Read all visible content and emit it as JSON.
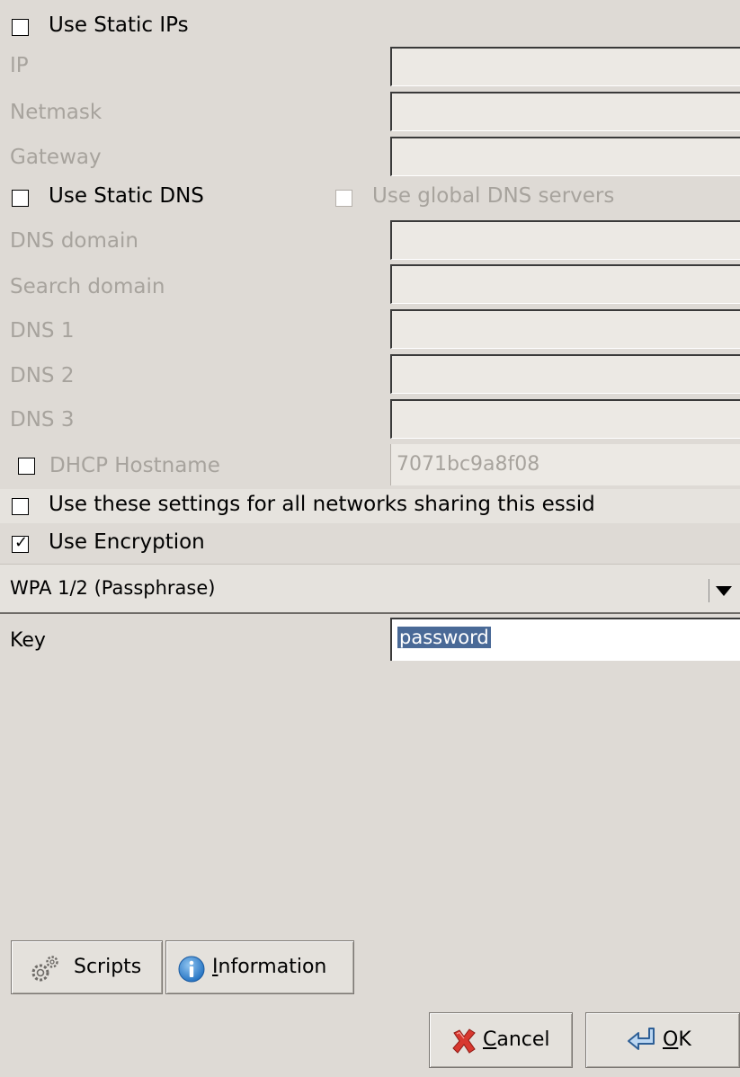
{
  "static_ip": {
    "checkbox_label": "Use Static IPs",
    "checked": false,
    "fields": [
      {
        "label": "IP",
        "value": ""
      },
      {
        "label": "Netmask",
        "value": ""
      },
      {
        "label": "Gateway",
        "value": ""
      }
    ]
  },
  "static_dns": {
    "checkbox_label": "Use Static DNS",
    "checked": false,
    "global_dns_label": "Use global DNS servers",
    "global_dns_checked": false,
    "fields": [
      {
        "label": "DNS domain",
        "value": ""
      },
      {
        "label": "Search domain",
        "value": ""
      },
      {
        "label": "DNS 1",
        "value": ""
      },
      {
        "label": "DNS 2",
        "value": ""
      },
      {
        "label": "DNS 3",
        "value": ""
      }
    ]
  },
  "dhcp": {
    "label": "DHCP Hostname",
    "checked": false,
    "value": "7071bc9a8f08"
  },
  "share_essid": {
    "label": "Use these settings for all networks sharing this essid",
    "checked": false
  },
  "encryption": {
    "label": "Use Encryption",
    "checked": true,
    "checkmark": "✓",
    "type_selected": "WPA 1/2 (Passphrase)",
    "key_label": "Key",
    "key_value": "password"
  },
  "buttons": {
    "scripts": "Scripts",
    "information_mnemonic": "I",
    "information_rest": "nformation",
    "cancel_mnemonic": "C",
    "cancel_rest": "ancel",
    "ok_mnemonic": "O",
    "ok_rest": "K"
  },
  "icons": {
    "scripts": "gears-icon",
    "information": "info-icon",
    "cancel": "cancel-x-icon",
    "ok": "return-arrow-icon"
  },
  "colors": {
    "background": "#dedad5",
    "selection": "#4a6a97",
    "disabled_text": "#a7a39d"
  }
}
